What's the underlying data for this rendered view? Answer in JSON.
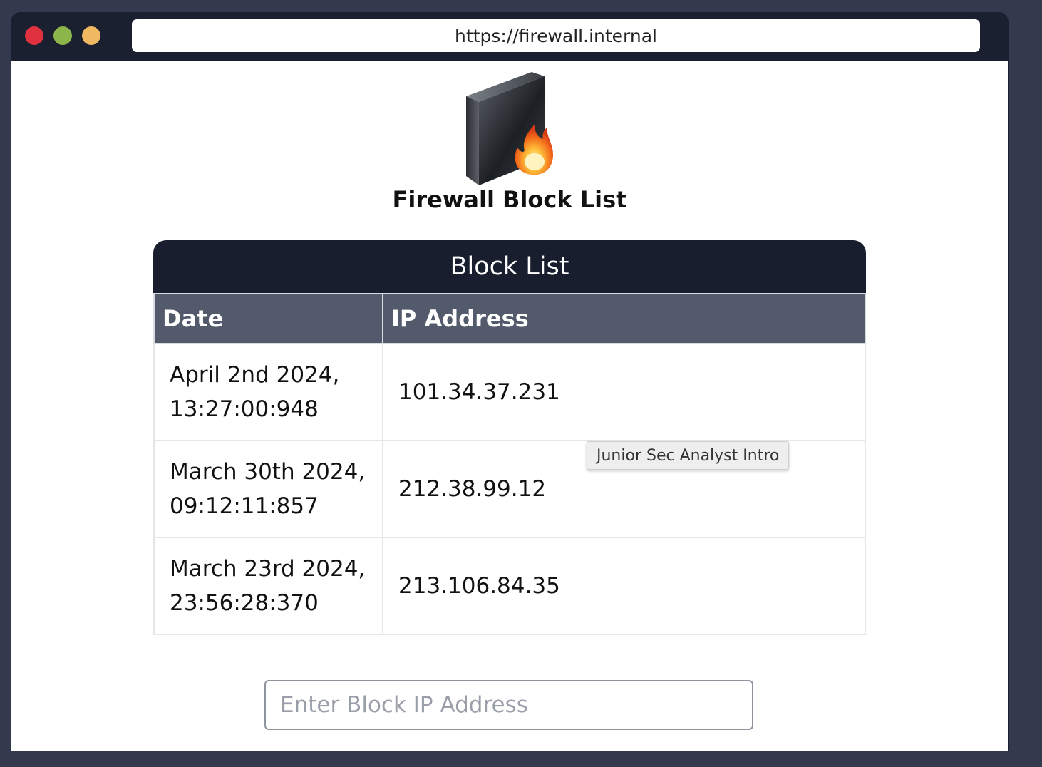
{
  "browser": {
    "url": "https://firewall.internal"
  },
  "page": {
    "logo_icon": "firewall-icon",
    "title": "Firewall Block List"
  },
  "block_list": {
    "header": "Block List",
    "columns": [
      "Date",
      "IP Address"
    ],
    "rows": [
      {
        "date_line1": "April 2nd 2024,",
        "date_line2": "13:27:00:948",
        "ip": "101.34.37.231"
      },
      {
        "date_line1": "March 30th 2024,",
        "date_line2": "09:12:11:857",
        "ip": "212.38.99.12"
      },
      {
        "date_line1": "March 23rd 2024,",
        "date_line2": "23:56:28:370",
        "ip": "213.106.84.35"
      }
    ]
  },
  "tooltip": "Junior Sec Analyst Intro",
  "input": {
    "placeholder": "Enter Block IP Address",
    "value": ""
  },
  "colors": {
    "background": "#343a4e",
    "titlebar": "#1b2030",
    "card_header": "#181e2d",
    "table_header": "#535a6b",
    "dot_red": "#e0313f",
    "dot_green": "#8db64a",
    "dot_yellow": "#f1b862"
  }
}
